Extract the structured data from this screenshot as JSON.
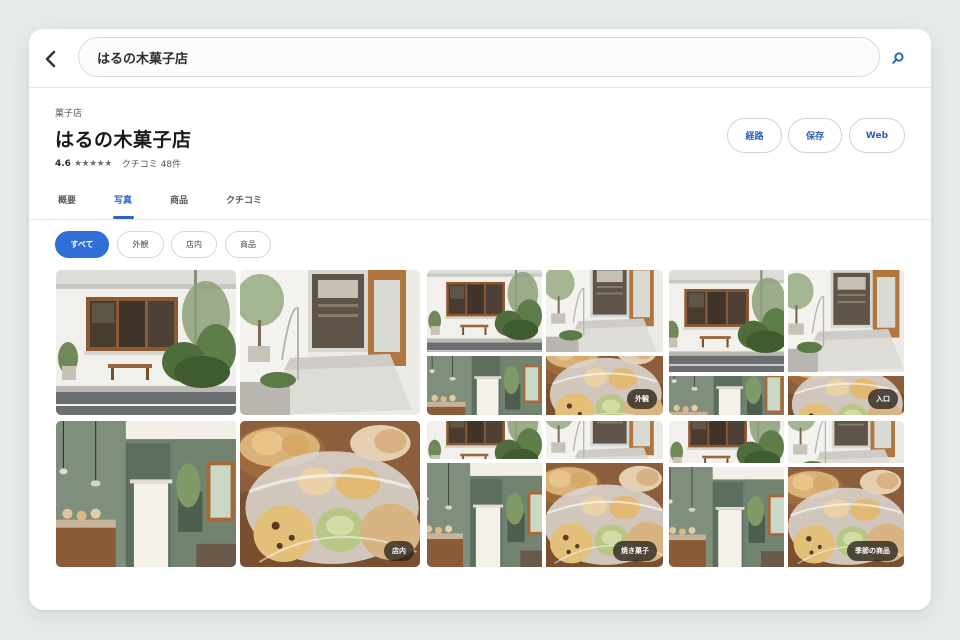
{
  "search": {
    "query": "はるの木菓子店"
  },
  "place": {
    "category": "菓子店",
    "name": "はるの木菓子店",
    "rating": "4.6",
    "stars": "★★★★★",
    "reviews": "クチコミ 48件"
  },
  "actions": [
    "経路",
    "保存",
    "Web"
  ],
  "tabs": [
    "概要",
    "写真",
    "商品",
    "クチコミ"
  ],
  "active_tab": "写真",
  "filters": [
    "すべて",
    "外観",
    "店内",
    "商品"
  ],
  "active_filter": "すべて",
  "photo_labels": {
    "exterior": "外観",
    "entrance": "入口",
    "interior": "店内",
    "baked": "焼き菓子",
    "seasonal": "季節の商品"
  },
  "colors": {
    "accent": "#2f6fd6",
    "link": "#2a5fb8",
    "wall": "#f2f1ee",
    "wood": "#a0683a",
    "green_wall": "#6b7d6c"
  },
  "icons": {
    "back": "chevron-left-icon",
    "search": "search-icon"
  }
}
